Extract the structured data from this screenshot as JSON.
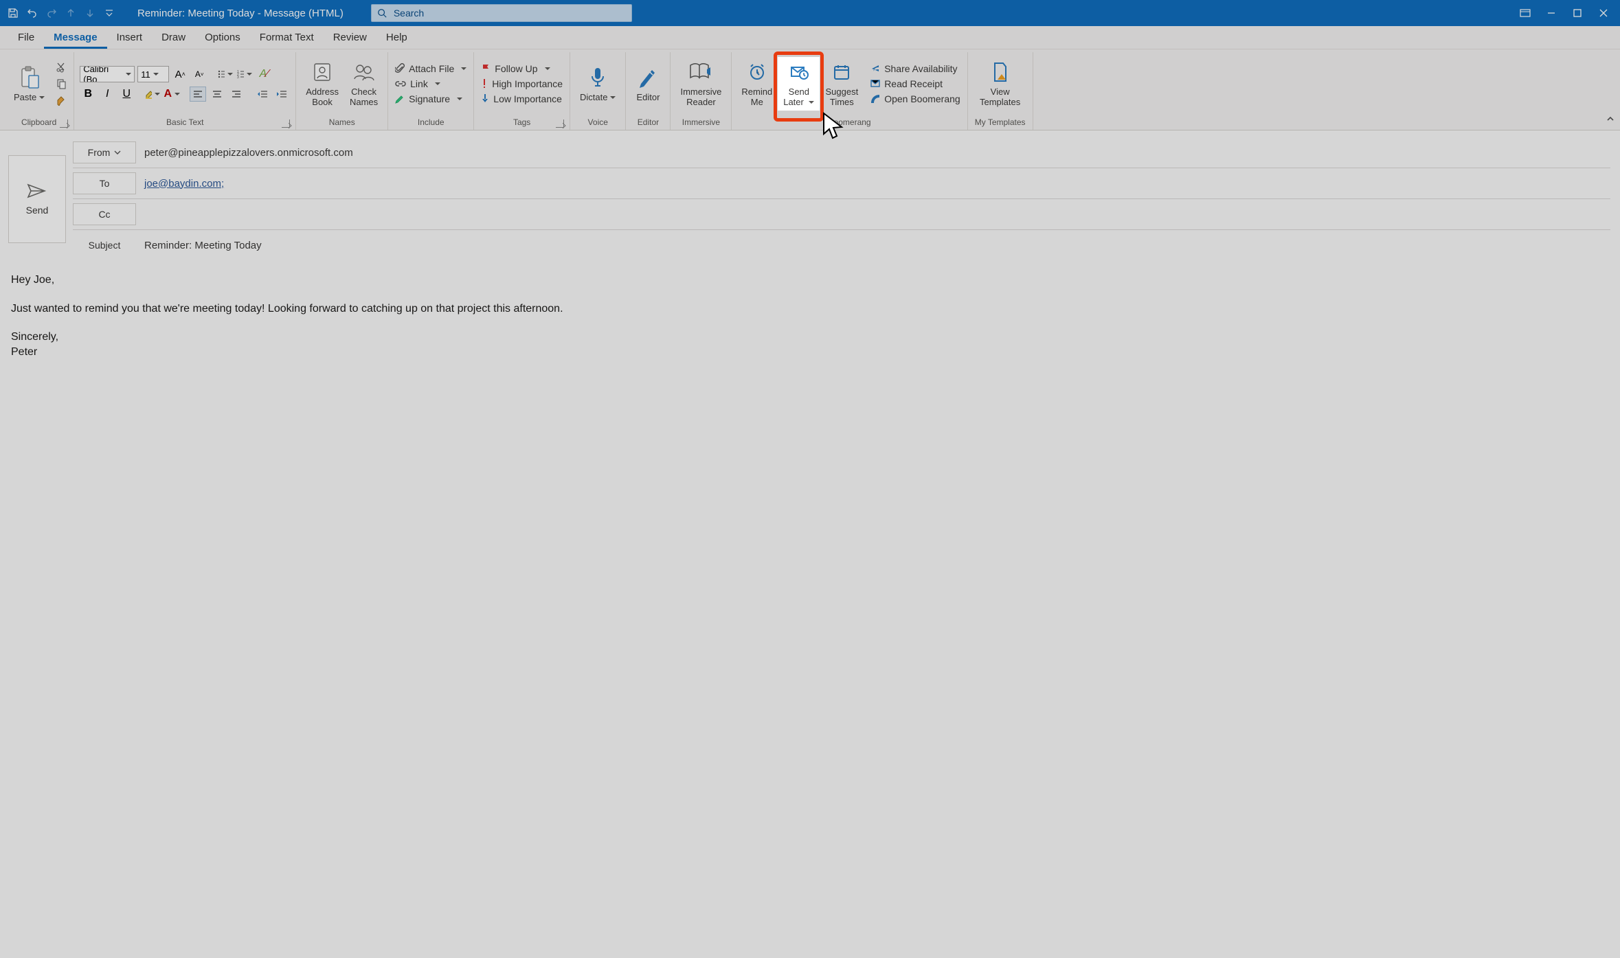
{
  "titlebar": {
    "title": "Reminder: Meeting Today  -  Message (HTML)",
    "search_placeholder": "Search"
  },
  "tabs": [
    "File",
    "Message",
    "Insert",
    "Draw",
    "Options",
    "Format Text",
    "Review",
    "Help"
  ],
  "active_tab": "Message",
  "ribbon": {
    "clipboard": {
      "label": "Clipboard",
      "paste": "Paste"
    },
    "basic_text": {
      "label": "Basic Text",
      "font_name": "Calibri (Bo",
      "font_size": "11"
    },
    "names": {
      "label": "Names",
      "address_book": "Address\nBook",
      "check_names": "Check\nNames"
    },
    "include": {
      "label": "Include",
      "attach_file": "Attach File",
      "link": "Link",
      "signature": "Signature"
    },
    "tags": {
      "label": "Tags",
      "follow_up": "Follow Up",
      "high": "High Importance",
      "low": "Low Importance"
    },
    "voice": {
      "label": "Voice",
      "dictate": "Dictate"
    },
    "editor": {
      "label": "Editor",
      "editor": "Editor"
    },
    "immersive": {
      "label": "Immersive",
      "reader": "Immersive\nReader"
    },
    "boomerang": {
      "label": "Boomerang",
      "remind_me": "Remind\nMe",
      "send_later": "Send\nLater",
      "suggest_times": "Suggest\nTimes",
      "share": "Share Availability",
      "read_receipt": "Read Receipt",
      "open": "Open Boomerang"
    },
    "templates": {
      "label": "My Templates",
      "view": "View\nTemplates"
    }
  },
  "compose": {
    "send": "Send",
    "from_label": "From",
    "from_value": "peter@pineapplepizzalovers.onmicrosoft.com",
    "to_label": "To",
    "to_value": "joe@baydin.com",
    "cc_label": "Cc",
    "subject_label": "Subject",
    "subject_value": "Reminder: Meeting Today",
    "body_lines": [
      "Hey Joe,",
      "Just wanted to remind you that we're meeting today! Looking forward to catching up on that project this afternoon.",
      "Sincerely,",
      "Peter"
    ]
  }
}
